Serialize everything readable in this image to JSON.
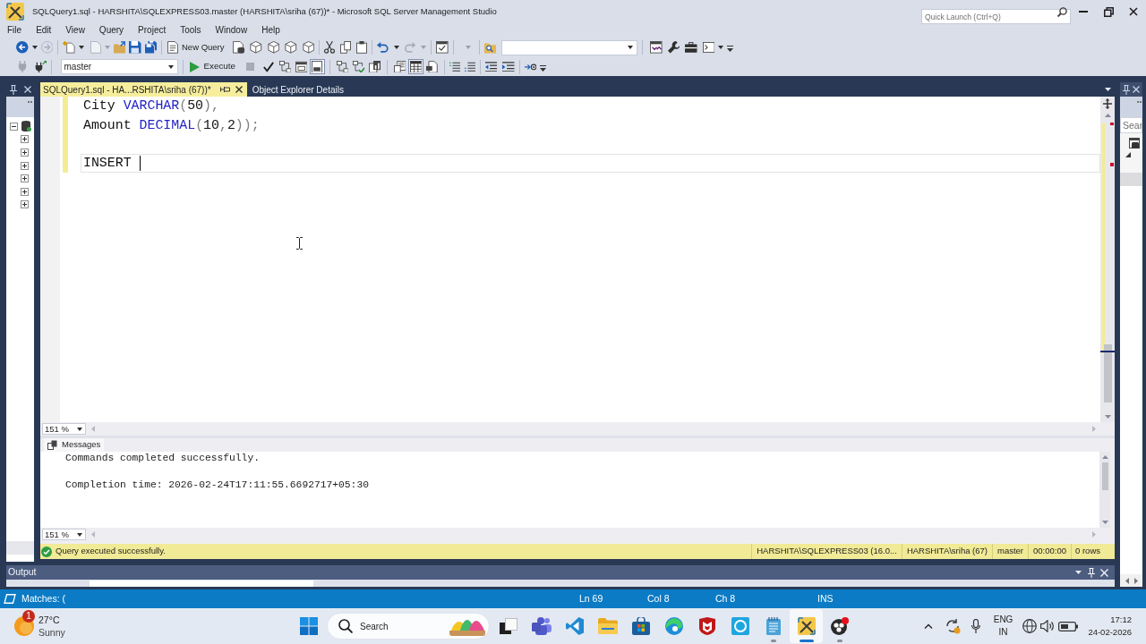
{
  "window": {
    "title": "SQLQuery1.sql - HARSHITA\\SQLEXPRESS03.master (HARSHITA\\sriha (67))* - Microsoft SQL Server Management Studio",
    "quick_launch": {
      "placeholder": "Quick Launch (Ctrl+Q)"
    }
  },
  "menu": [
    "File",
    "Edit",
    "View",
    "Query",
    "Project",
    "Tools",
    "Window",
    "Help"
  ],
  "toolbar_1": {
    "new_query": "New Query"
  },
  "toolbar_2": {
    "database": "master",
    "execute": "Execute",
    "toggle_buttons": [
      {
        "on": false
      },
      {
        "on": false
      },
      {
        "on": true
      },
      {
        "on": false
      },
      {
        "on": false
      },
      {
        "on": false
      },
      {
        "on": false
      },
      {
        "on": true
      },
      {
        "on": false
      }
    ]
  },
  "object_explorer": {
    "tree": [
      {
        "expanded": true,
        "children": [
          {
            "expanded": false
          },
          {
            "expanded": false
          },
          {
            "expanded": false
          },
          {
            "expanded": false
          },
          {
            "expanded": false
          },
          {
            "expanded": false
          }
        ]
      }
    ]
  },
  "tabs": [
    {
      "label": "SQLQuery1.sql - HA...RSHITA\\sriha (67))*",
      "selected": true
    },
    {
      "label": "Object Explorer Details",
      "selected": false
    }
  ],
  "editor": {
    "lines": [
      {
        "modified": true,
        "current": false,
        "tokens": [
          {
            "text": "City ",
            "kind": "plain"
          },
          {
            "text": "VARCHAR",
            "kind": "keyword"
          },
          {
            "text": "(",
            "kind": "operator"
          },
          {
            "text": "50",
            "kind": "plain"
          },
          {
            "text": "),",
            "kind": "operator"
          }
        ]
      },
      {
        "modified": true,
        "current": false,
        "tokens": [
          {
            "text": "Amount ",
            "kind": "plain"
          },
          {
            "text": "DECIMAL",
            "kind": "keyword"
          },
          {
            "text": "(",
            "kind": "operator"
          },
          {
            "text": "10",
            "kind": "plain"
          },
          {
            "text": ",",
            "kind": "operator"
          },
          {
            "text": "2",
            "kind": "plain"
          },
          {
            "text": "));",
            "kind": "operator"
          }
        ]
      },
      {
        "modified": true,
        "current": false
      },
      {
        "modified": true,
        "current": true,
        "tokens": [
          {
            "text": "INSERT ",
            "kind": "plain"
          }
        ]
      }
    ],
    "zoom": "151 %"
  },
  "results": {
    "tab": "Messages",
    "lines": [
      "Commands completed successfully.",
      "Completion time: 2026-02-24T17:11:55.6692717+05:30"
    ],
    "zoom": "151 %"
  },
  "query_status": {
    "message": "Query executed successfully.",
    "fields": [
      "HARSHITA\\SQLEXPRESS03 (16.0...",
      "HARSHITA\\sriha (67)",
      "master",
      "00:00:00",
      "0 rows"
    ]
  },
  "output_panel": {
    "title": "Output"
  },
  "right_panel": {
    "search": {
      "placeholder": "Sear"
    }
  },
  "status_bar": {
    "find_result": "Matches: (",
    "line": "Ln 69",
    "column": "Col 8",
    "character": "Ch 8",
    "mode": "INS"
  },
  "taskbar": {
    "weather": {
      "badge": "1",
      "temperature": "27°C",
      "condition": "Sunny"
    },
    "search": {
      "label": "Search"
    },
    "apps": [
      {
        "running": false,
        "selected": false
      },
      {
        "running": false,
        "selected": false
      },
      {
        "running": false,
        "selected": false
      },
      {
        "running": false,
        "selected": false
      },
      {
        "running": false,
        "selected": false
      },
      {
        "running": false,
        "selected": false
      },
      {
        "running": false,
        "selected": false
      },
      {
        "running": false,
        "selected": false
      },
      {
        "running": true,
        "selected": false
      },
      {
        "running": true,
        "selected": true
      },
      {
        "running": true,
        "selected": false
      }
    ],
    "tray": {
      "language": "ENG",
      "region": "IN"
    },
    "clock": {
      "time": "17:12",
      "date": "24-02-2026"
    }
  }
}
